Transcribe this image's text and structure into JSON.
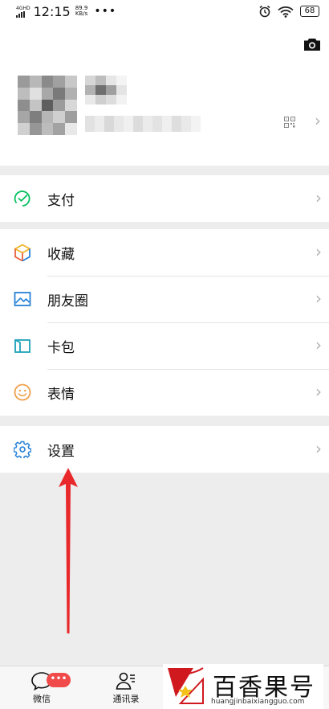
{
  "status_bar": {
    "network": "4G",
    "network_sub": "HD",
    "time": "12:15",
    "speed_value": "89.9",
    "speed_unit": "KB/s",
    "more": "•••",
    "battery": "68"
  },
  "profile": {
    "camera_icon": "camera-icon",
    "qr_icon": "qr-code-icon"
  },
  "menu": {
    "pay": {
      "label": "支付",
      "icon": "wallet-check-icon",
      "color": "#07c160"
    },
    "favorites": {
      "label": "收藏",
      "icon": "cube-icon"
    },
    "moments": {
      "label": "朋友圈",
      "icon": "image-icon",
      "color": "#2782d7"
    },
    "cards": {
      "label": "卡包",
      "icon": "card-icon",
      "color": "#1aa0b8"
    },
    "stickers": {
      "label": "表情",
      "icon": "smiley-icon",
      "color": "#f0a04b"
    },
    "settings": {
      "label": "设置",
      "icon": "gear-icon",
      "color": "#2782d7"
    }
  },
  "tabs": {
    "chats": {
      "label": "微信",
      "badge": "•••"
    },
    "contacts": {
      "label": "通讯录"
    }
  },
  "watermark": {
    "brand_cn": "百香果号",
    "domain": "huangjinbaixiangguo.com"
  },
  "colors": {
    "annotation_arrow": "#e8282b",
    "badge": "#f04a4a",
    "page_bg": "#ededed"
  }
}
